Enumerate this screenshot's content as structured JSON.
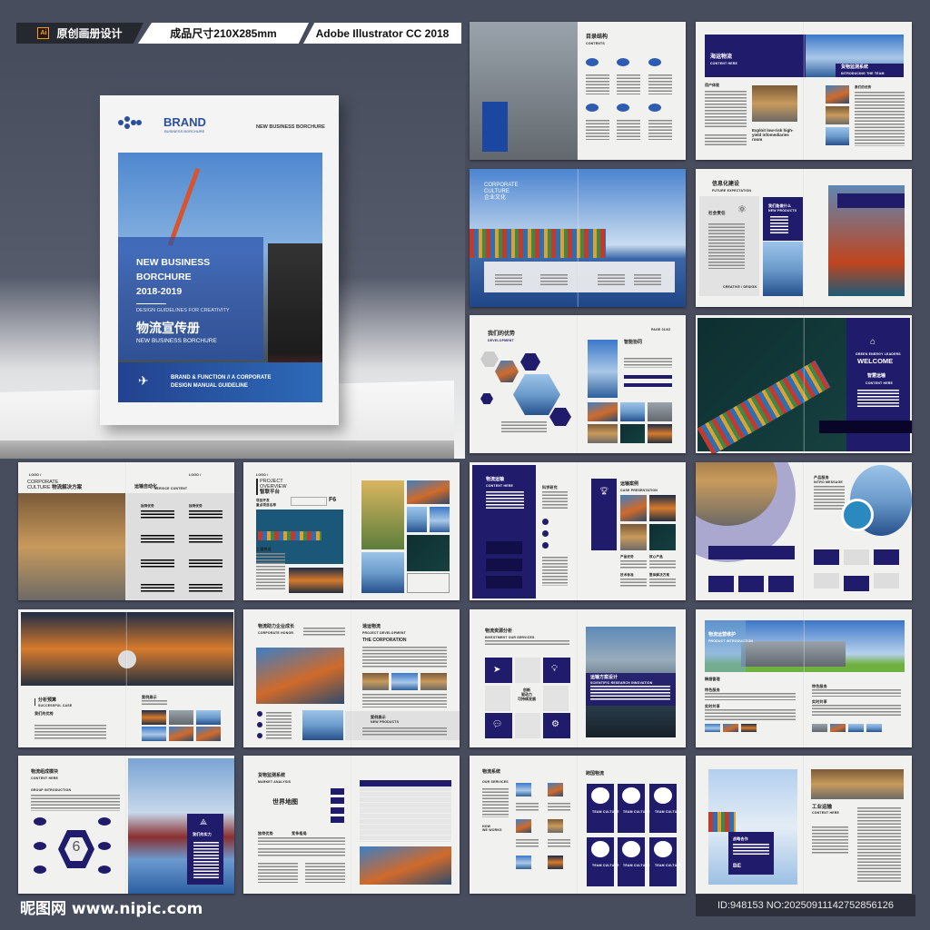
{
  "header": {
    "ai_badge": "Ai",
    "tag_design": "原创画册设计",
    "tag_size": "成品尺寸210X285mm",
    "tag_software": "Adobe Illustrator CC 2018"
  },
  "cover": {
    "brand": "BRAND",
    "brand_sub": "BUSINESS BORCHURE",
    "top_right": "NEW BUSINESS BORCHURE",
    "title_line1": "NEW BUSINESS",
    "title_line2": "BORCHURE",
    "years": "2018-2019",
    "guideline": "DESIGN GUIDELINES FOR CREATIVITY",
    "title_cn": "物流宣传册",
    "subtitle": "NEW BUSINESS BORCHURE",
    "footer_line1": "BRAND & FUNCTION // A CORPORATE",
    "footer_line2": "DESIGN MANUAL GUIDELINE"
  },
  "spreads": {
    "contents": {
      "title": "目录结构",
      "sub": "CONTENTS"
    },
    "sea": {
      "title": "海运物流",
      "sub": "CONTENT HERE",
      "banner_title": "货物监测系统",
      "banner_sub": "INTRODUCING THE TEAM",
      "section": "用户体验",
      "exploit": "Exploit low-risk high-yield infomediaries room",
      "right_label": "我们的优势"
    },
    "culture": {
      "line1": "CORPORATE",
      "line2": "CULTURE",
      "cn": "企业文化"
    },
    "info": {
      "title": "信息化建设",
      "sub": "FUTURE EXPECTATION",
      "box": "社会责任",
      "nv_title": "我们能做什么",
      "nv_sub": "NEW PRODUCTS",
      "foot": "CREATIVE / DESIGN"
    },
    "advantage": {
      "title": "我们的优势",
      "sub": "DEVELOPMENT",
      "page": "PAGE 01/02",
      "right_title": "智能协同"
    },
    "welcome": {
      "leaders": "GREEN ENERGY LEADERS",
      "welcome": "WELCOME",
      "cn": "智慧运输",
      "sub": "CONTENT HERE"
    },
    "solution": {
      "logo": "LOGO /",
      "line1": "CORPORATE",
      "line2": "CULTURE",
      "cn": "物流解决方案",
      "right_title": "运输自动化",
      "right_sub": "SERVICE CONTENT",
      "item": "独特优势"
    },
    "project": {
      "logo": "LOGO /",
      "line1": "PROJECT",
      "line2": "OVERVIEW",
      "cn": "智联平台",
      "code": "F6",
      "dev": "项目开发",
      "name": "重点项目名称",
      "feature": "工程特点"
    },
    "transport": {
      "title": "物流运输",
      "sub": "CONTENT HERE",
      "research": "科学研究",
      "case": "运输案例",
      "case_sub": "CASE PRESENTATION",
      "labels": [
        "产品优势",
        "核心产品",
        "技术标准",
        "整体解决方案"
      ]
    },
    "service": {
      "title": "产品服务",
      "sub": "INTRO MESSAGE"
    },
    "budget": {
      "title": "分析预算",
      "sub": "SUCCESSFUL CASE",
      "adv": "我们的优势",
      "show": "案例展示"
    },
    "growth": {
      "title": "物流助力企业成长",
      "sub": "CORPORATE HONOR",
      "right_title": "速运物流",
      "right_sub": "PROJECT DEVELOPMENT",
      "corp": "THE CORPORATION",
      "show": "案例展示",
      "new": "NEW PRODUCTS"
    },
    "resource": {
      "title": "物流资源分析",
      "sub": "INVESTMENT OUR SERVICES",
      "center1": "创新",
      "center2": "驱动力",
      "center3": "可持续发展",
      "plan": "运输方案设计",
      "plan_sub": "SCIENTIFIC RESEARCH INNOVATION"
    },
    "ops": {
      "title": "物流运营维护",
      "sub": "PRODUCT INTRODUCTION",
      "s1": "精细管理",
      "s2": "特色服务",
      "s3": "实时共享"
    },
    "module": {
      "title": "物流组成模块",
      "sub": "CONTENT HERE",
      "group": "GROUP INTRODUCTION",
      "num": "6",
      "card": "我们的实力"
    },
    "monitor": {
      "title": "货物监测系统",
      "sub": "MARKET ANALYSIS",
      "map": "世界地图",
      "c1": "独特优势",
      "c2": "竞争格局"
    },
    "system": {
      "title": "物流系统",
      "sub": "OUR SERVICES",
      "how1": "HOW",
      "how2": "WE WORKS",
      "right_title": "跨国物流",
      "card_sub": "TEAM CULTURE"
    },
    "industry": {
      "box_title": "战略合作",
      "be": "BE",
      "title": "工业运输",
      "sub": "CONTENT HERE"
    }
  },
  "footer": {
    "watermark": "昵图网 www.nipic.com",
    "id": "ID:948153 NO:20250911142752856126"
  },
  "colors": {
    "background": "#484d5e",
    "navy": "#211b6c",
    "cover_blue": "#2a5aa8"
  }
}
